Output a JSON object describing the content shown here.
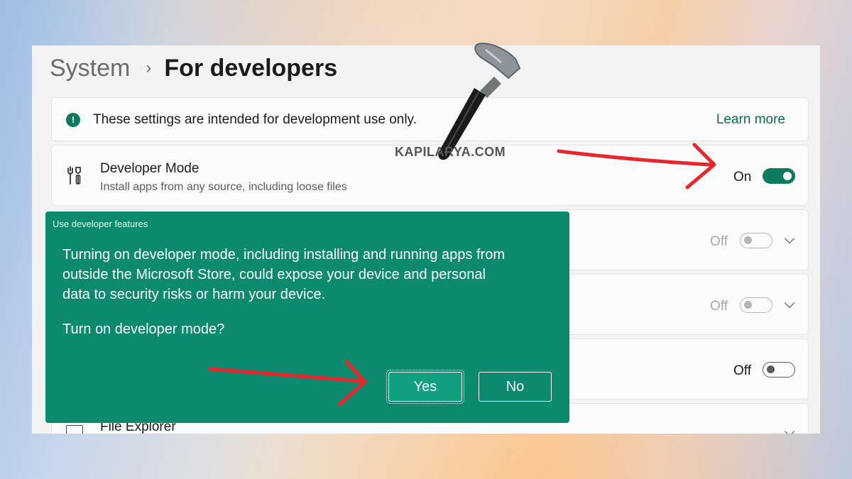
{
  "breadcrumb": {
    "parent": "System",
    "separator": "›",
    "current": "For developers"
  },
  "info": {
    "text": "These settings are intended for development use only.",
    "link": "Learn more",
    "icon": "info-icon"
  },
  "developer_mode": {
    "title": "Developer Mode",
    "subtitle": "Install apps from any source, including loose files",
    "toggle_label": "On",
    "toggle_state": "on"
  },
  "rows": [
    {
      "toggle_label": "Off",
      "toggle_state": "off",
      "expandable": true
    },
    {
      "toggle_label": "Off",
      "toggle_state": "off",
      "expandable": true
    },
    {
      "toggle_label": "Off",
      "toggle_state": "off",
      "expandable": false
    },
    {
      "title": "File Explorer",
      "icon": "folder-icon",
      "expandable": true
    }
  ],
  "watermark": {
    "text": "KAPILARYA.COM",
    "icon": "hammer-icon"
  },
  "dialog": {
    "title": "Use developer features",
    "body": "Turning on developer mode, including installing and running apps from outside the Microsoft Store, could expose your device and personal data to security risks or harm your device.",
    "question": "Turn on developer mode?",
    "yes_label": "Yes",
    "no_label": "No"
  },
  "colors": {
    "accent": "#0e7a5f",
    "dialog_bg": "#0b8a6d",
    "annotation_arrow": "#e8262b"
  }
}
